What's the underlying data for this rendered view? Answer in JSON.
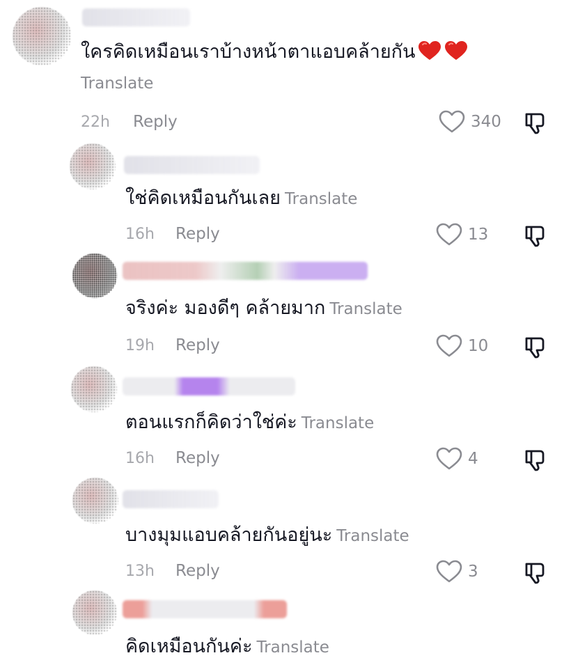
{
  "comments": [
    {
      "text": "ใครคิดเหมือนเราบ้างหน้าตาแอบคล้ายกัน",
      "emoji": [
        "red-heart",
        "red-heart"
      ],
      "translate": "Translate",
      "time": "22h",
      "reply": "Reply",
      "likes": "340"
    },
    {
      "text": "ใช่คิดเหมือนกันเลย",
      "translate": "Translate",
      "time": "16h",
      "reply": "Reply",
      "likes": "13"
    },
    {
      "text": "จริงค่ะ มองดีๆ คล้ายมาก",
      "translate": "Translate",
      "time": "19h",
      "reply": "Reply",
      "likes": "10"
    },
    {
      "text": "ตอนแรกก็คิดว่าใช่ค่ะ",
      "translate": "Translate",
      "time": "16h",
      "reply": "Reply",
      "likes": "4"
    },
    {
      "text": "บางมุมแอบคล้ายกันอยู่นะ",
      "translate": "Translate",
      "time": "13h",
      "reply": "Reply",
      "likes": "3"
    },
    {
      "text": "คิดเหมือนกันค่ะ",
      "translate": "Translate"
    }
  ],
  "icons": {
    "like": "heart-outline-icon",
    "dislike": "thumbs-down-outline-icon"
  },
  "colors": {
    "primary_text": "#161823",
    "secondary_text": "#8a8b91",
    "timestamp": "#a7a8ad",
    "emoji_heart": "#e0241f"
  }
}
